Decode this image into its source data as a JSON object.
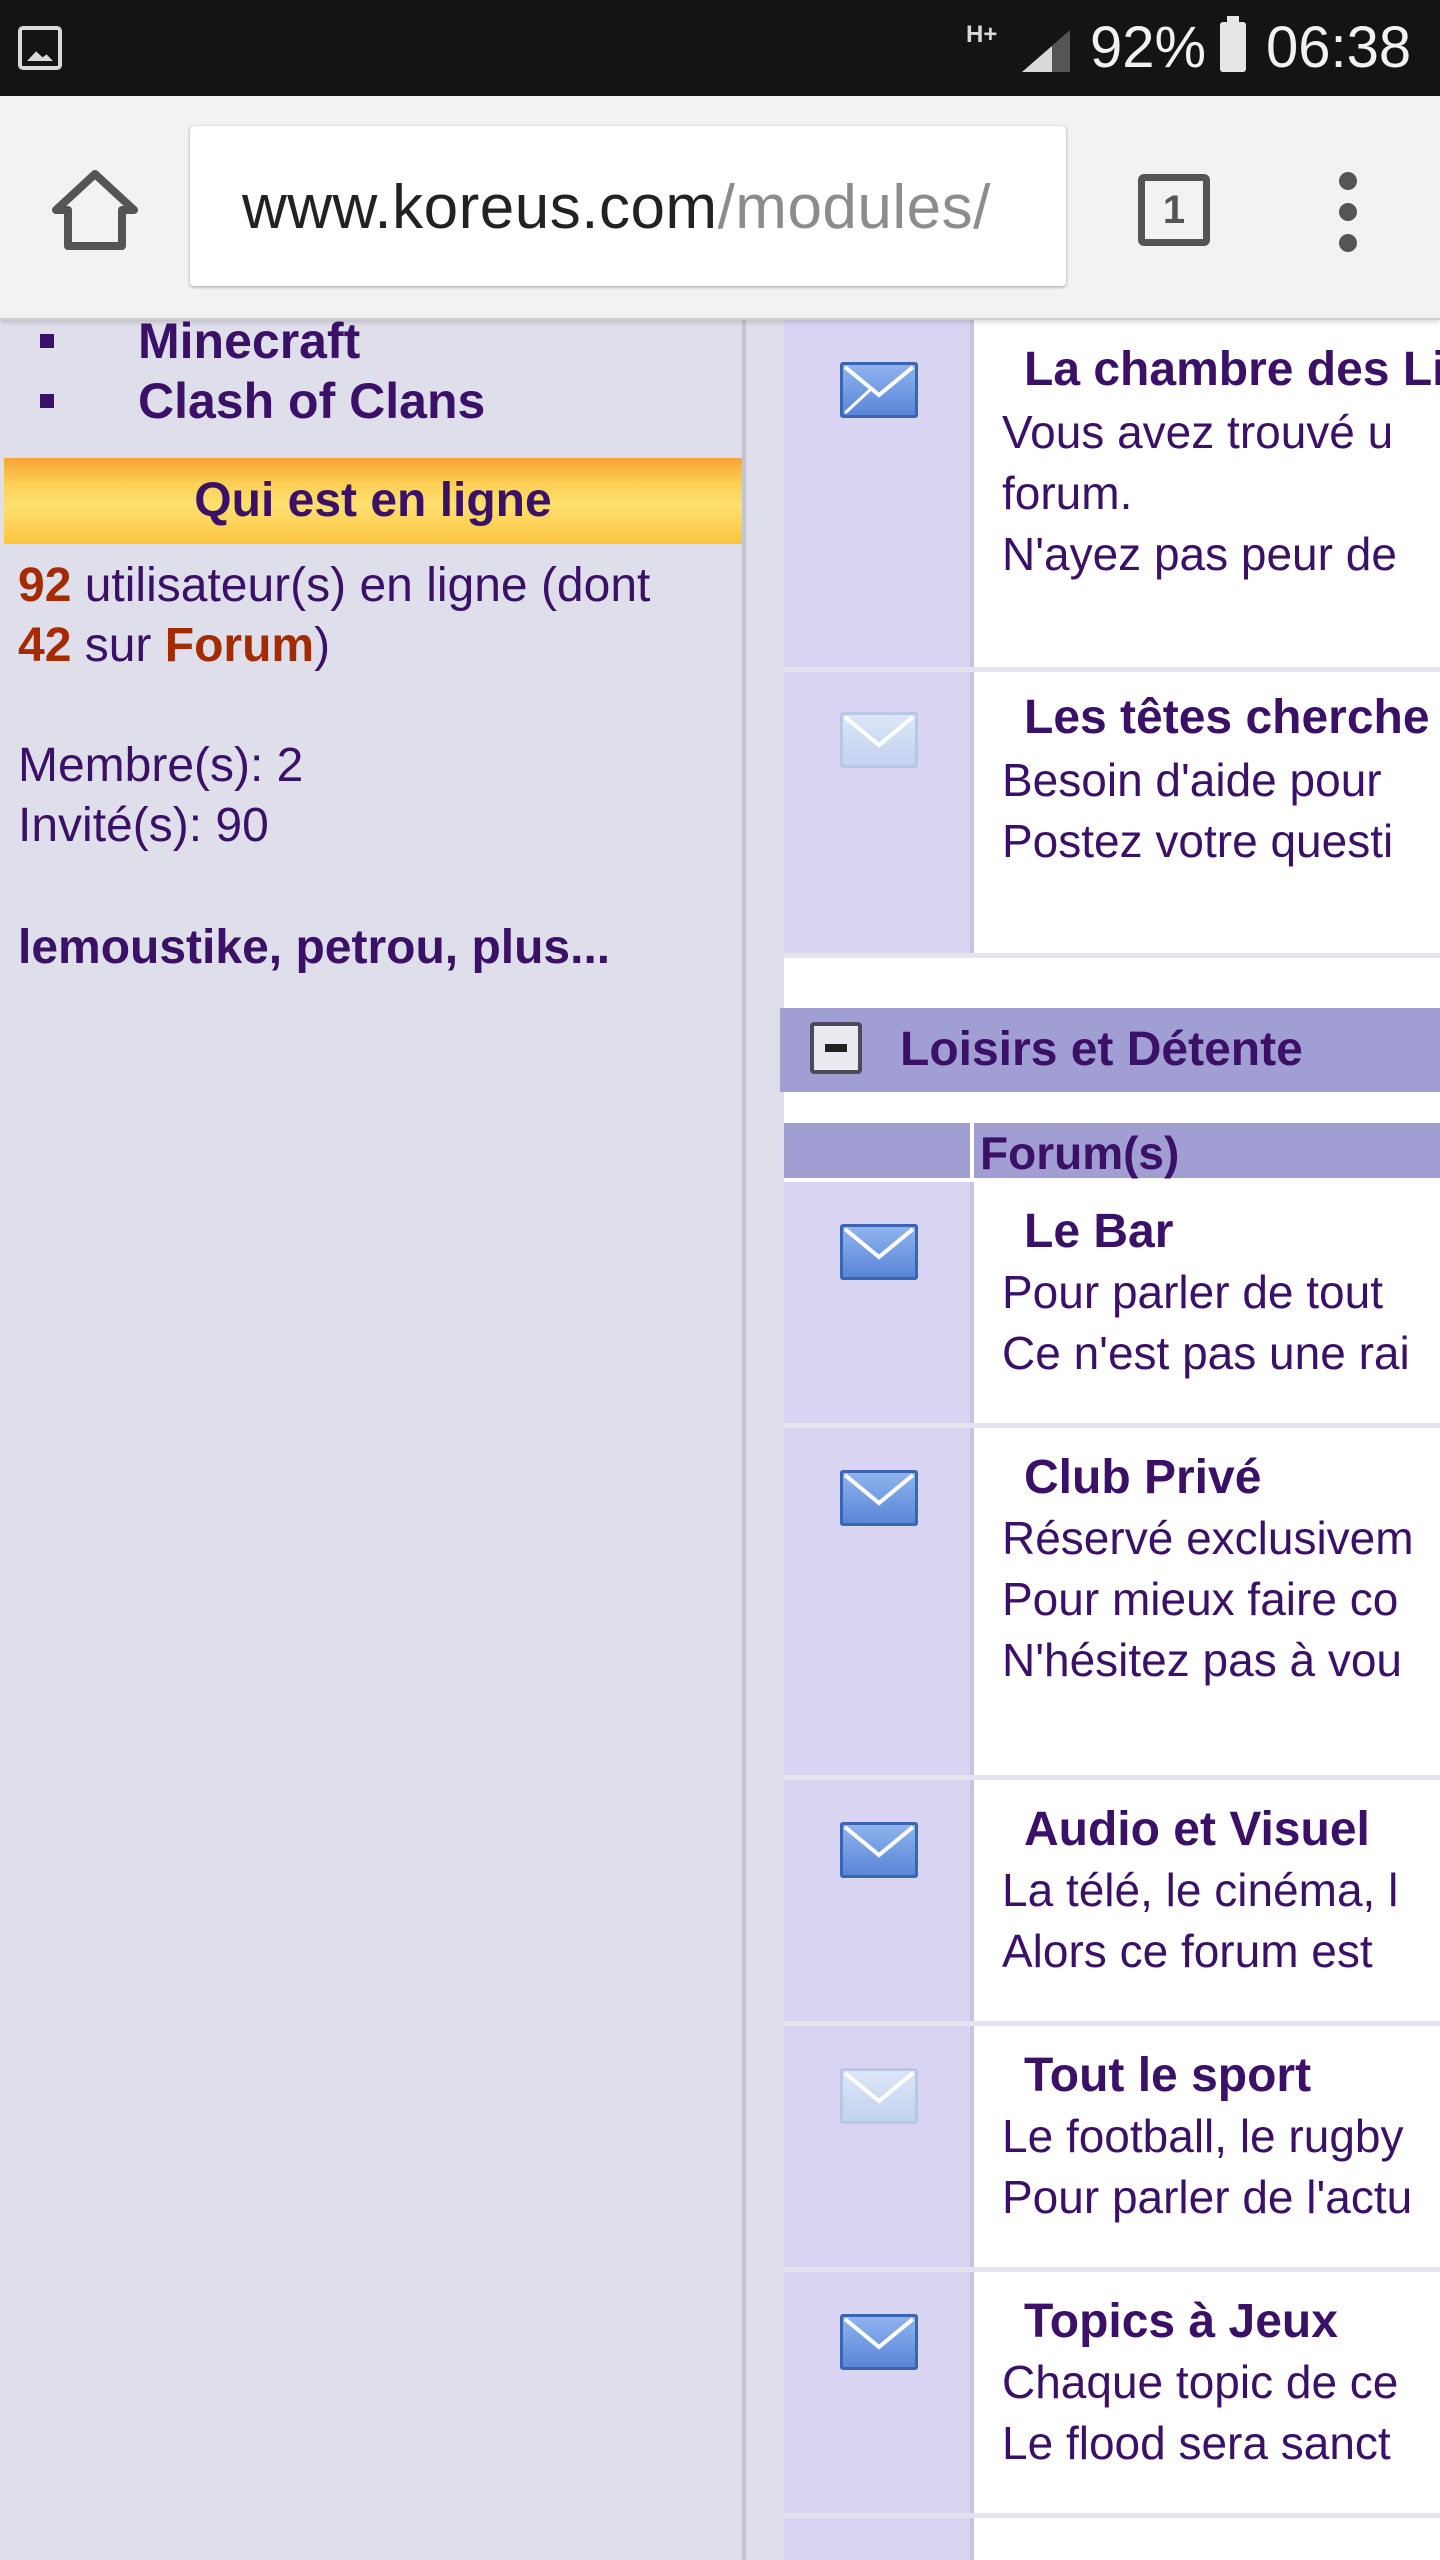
{
  "status_bar": {
    "network": "H+",
    "battery_percent": "92%",
    "time": "06:38"
  },
  "browser": {
    "url_host": "www.koreus.com",
    "url_path": "/modules/",
    "tab_count": "1"
  },
  "sidebar": {
    "game_links": [
      "Minecraft",
      "Clash of Clans"
    ],
    "online_title": "Qui est en ligne",
    "online_count": "92",
    "online_text": " utilisateur(s) en ligne (dont",
    "forum_count": "42",
    "forum_text_prefix": " sur ",
    "forum_link": "Forum",
    "forum_text_suffix": ")",
    "members_line": "Membre(s): 2",
    "guests_line": "Invité(s): 90",
    "members_list": {
      "member1": "lemoustike",
      "sep1": ", ",
      "member2": "petrou",
      "sep2": ", ",
      "more": "plus..."
    }
  },
  "forum": {
    "top_rows": [
      {
        "title": "La chambre des Li",
        "desc": [
          "Vous avez trouvé u",
          "forum.",
          "N'ayez pas peur de"
        ],
        "icon": "envelope-new-icon"
      },
      {
        "title": "Les têtes cherche",
        "desc": [
          "Besoin d'aide pour",
          "Postez votre questi"
        ],
        "icon": "envelope-read-icon"
      }
    ],
    "category": {
      "title": "Loisirs et Détente",
      "column_header": "Forum(s)"
    },
    "rows": [
      {
        "title": "Le Bar",
        "desc": [
          "Pour parler de tout",
          "Ce n'est pas une rai"
        ],
        "icon": "envelope-new-icon"
      },
      {
        "title": "Club Privé",
        "desc": [
          "Réservé exclusivem",
          "Pour mieux faire co",
          "N'hésitez pas à vou"
        ],
        "icon": "envelope-new-icon"
      },
      {
        "title": "Audio et Visuel",
        "desc": [
          "La télé, le cinéma, l",
          "Alors ce forum est"
        ],
        "icon": "envelope-new-icon"
      },
      {
        "title": "Tout le sport",
        "desc": [
          "Le football, le rugby",
          "Pour parler de l'actu"
        ],
        "icon": "envelope-read-icon"
      },
      {
        "title": "Topics à Jeux",
        "desc": [
          "Chaque topic de ce",
          "Le flood sera sanct"
        ],
        "icon": "envelope-new-icon"
      }
    ]
  },
  "colors": {
    "text_violet": "#3b1067",
    "text_red": "#a52a00",
    "sidebar_bg": "#dfdfeb",
    "category_bg": "#a19ed4",
    "icon_cell_bg": "#d8d4f2"
  }
}
